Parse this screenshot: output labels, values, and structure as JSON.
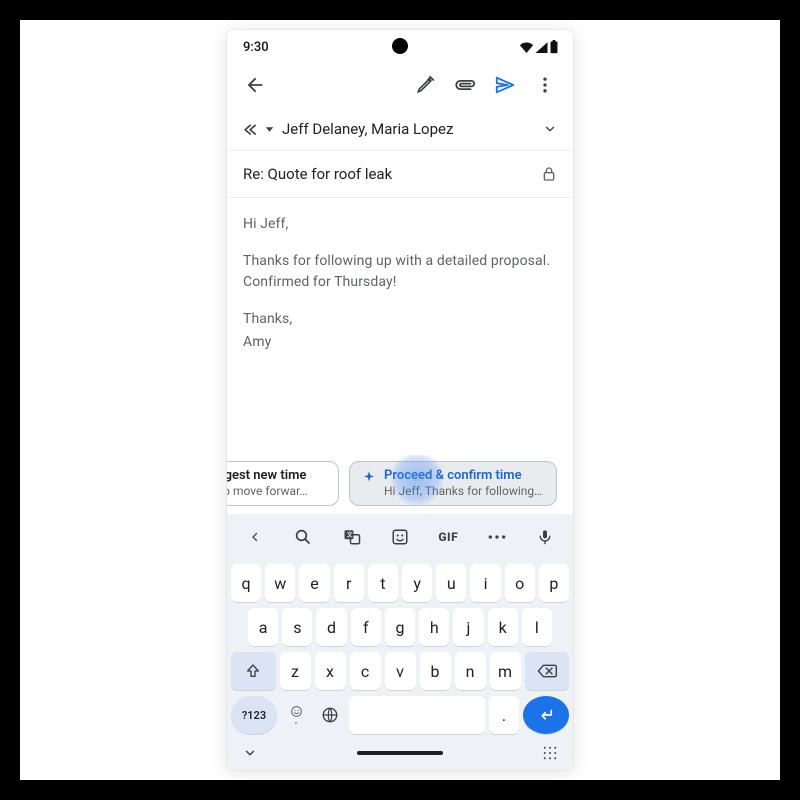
{
  "statusbar": {
    "time": "9:30"
  },
  "recipients": {
    "names": "Jeff Delaney, Maria Lopez"
  },
  "subject": {
    "text": "Re: Quote for roof leak"
  },
  "body": {
    "line1": "Hi Jeff,",
    "line2": "Thanks for following up with a detailed proposal. Confirmed for Thursday!",
    "line3": "Thanks,",
    "line4": "Amy"
  },
  "chips": {
    "left": {
      "title": "Suggest new time",
      "sub": "…e to move forwar…"
    },
    "right": {
      "title": "Proceed & confirm time",
      "sub": "Hi Jeff, Thanks for following up.…"
    }
  },
  "kbbar": {
    "gif": "GIF"
  },
  "keys": {
    "r1": [
      "q",
      "w",
      "e",
      "r",
      "t",
      "y",
      "u",
      "i",
      "o",
      "p"
    ],
    "r2": [
      "a",
      "s",
      "d",
      "f",
      "g",
      "h",
      "j",
      "k",
      "l"
    ],
    "r3": [
      "z",
      "x",
      "c",
      "v",
      "b",
      "n",
      "m"
    ],
    "sym": "?123",
    "period": "."
  }
}
